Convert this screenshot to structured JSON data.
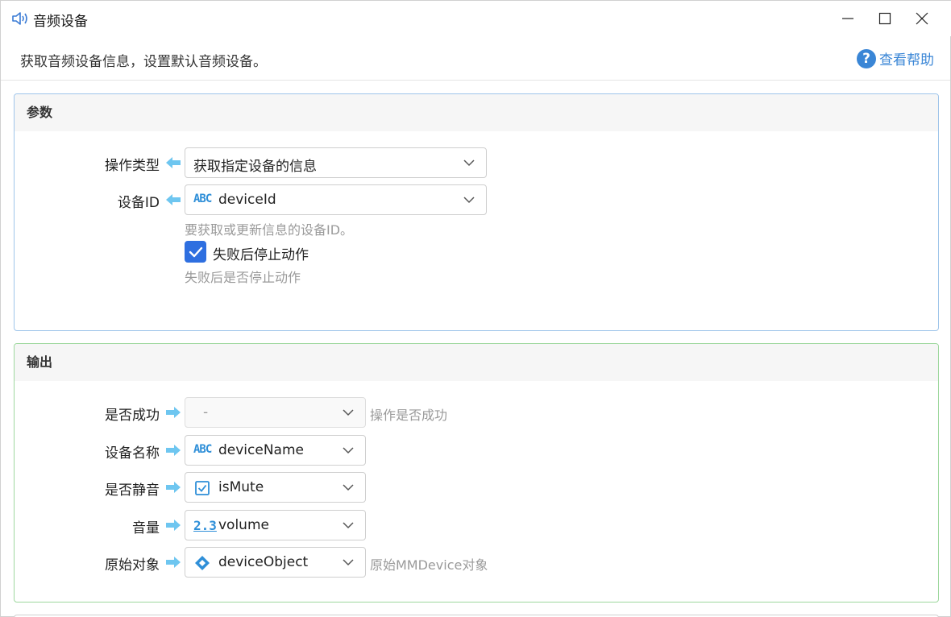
{
  "window": {
    "title": "音频设备",
    "description": "获取音频设备信息，设置默认音频设备。",
    "help_label": "查看帮助",
    "help_icon": "?"
  },
  "params": {
    "heading": "参数",
    "operation": {
      "label": "操作类型",
      "value": "获取指定设备的信息"
    },
    "device_id": {
      "label": "设备ID",
      "type_badge": "ABC",
      "value": "deviceId",
      "hint": "要获取或更新信息的设备ID。"
    },
    "stop_on_fail": {
      "label": "失败后停止动作",
      "checked": true,
      "hint": "失败后是否停止动作"
    }
  },
  "output": {
    "heading": "输出",
    "rows": [
      {
        "label": "是否成功",
        "type_badge": "",
        "value": "-",
        "hint": "操作是否成功"
      },
      {
        "label": "设备名称",
        "type_badge": "ABC",
        "value": "deviceName",
        "hint": ""
      },
      {
        "label": "是否静音",
        "type_badge": "checkbox",
        "value": "isMute",
        "hint": ""
      },
      {
        "label": "音量",
        "type_badge": "2.3",
        "value": "volume",
        "hint": ""
      },
      {
        "label": "原始对象",
        "type_badge": "object",
        "value": "deviceObject",
        "hint": "原始MMDevice对象"
      }
    ]
  },
  "colors": {
    "accent": "#2e6fe0",
    "link": "#3a86d6",
    "params_border": "#9fc5ea",
    "output_border": "#9ed89e",
    "arrow": "#6ec6f0",
    "type_icon": "#2f8fd8"
  }
}
